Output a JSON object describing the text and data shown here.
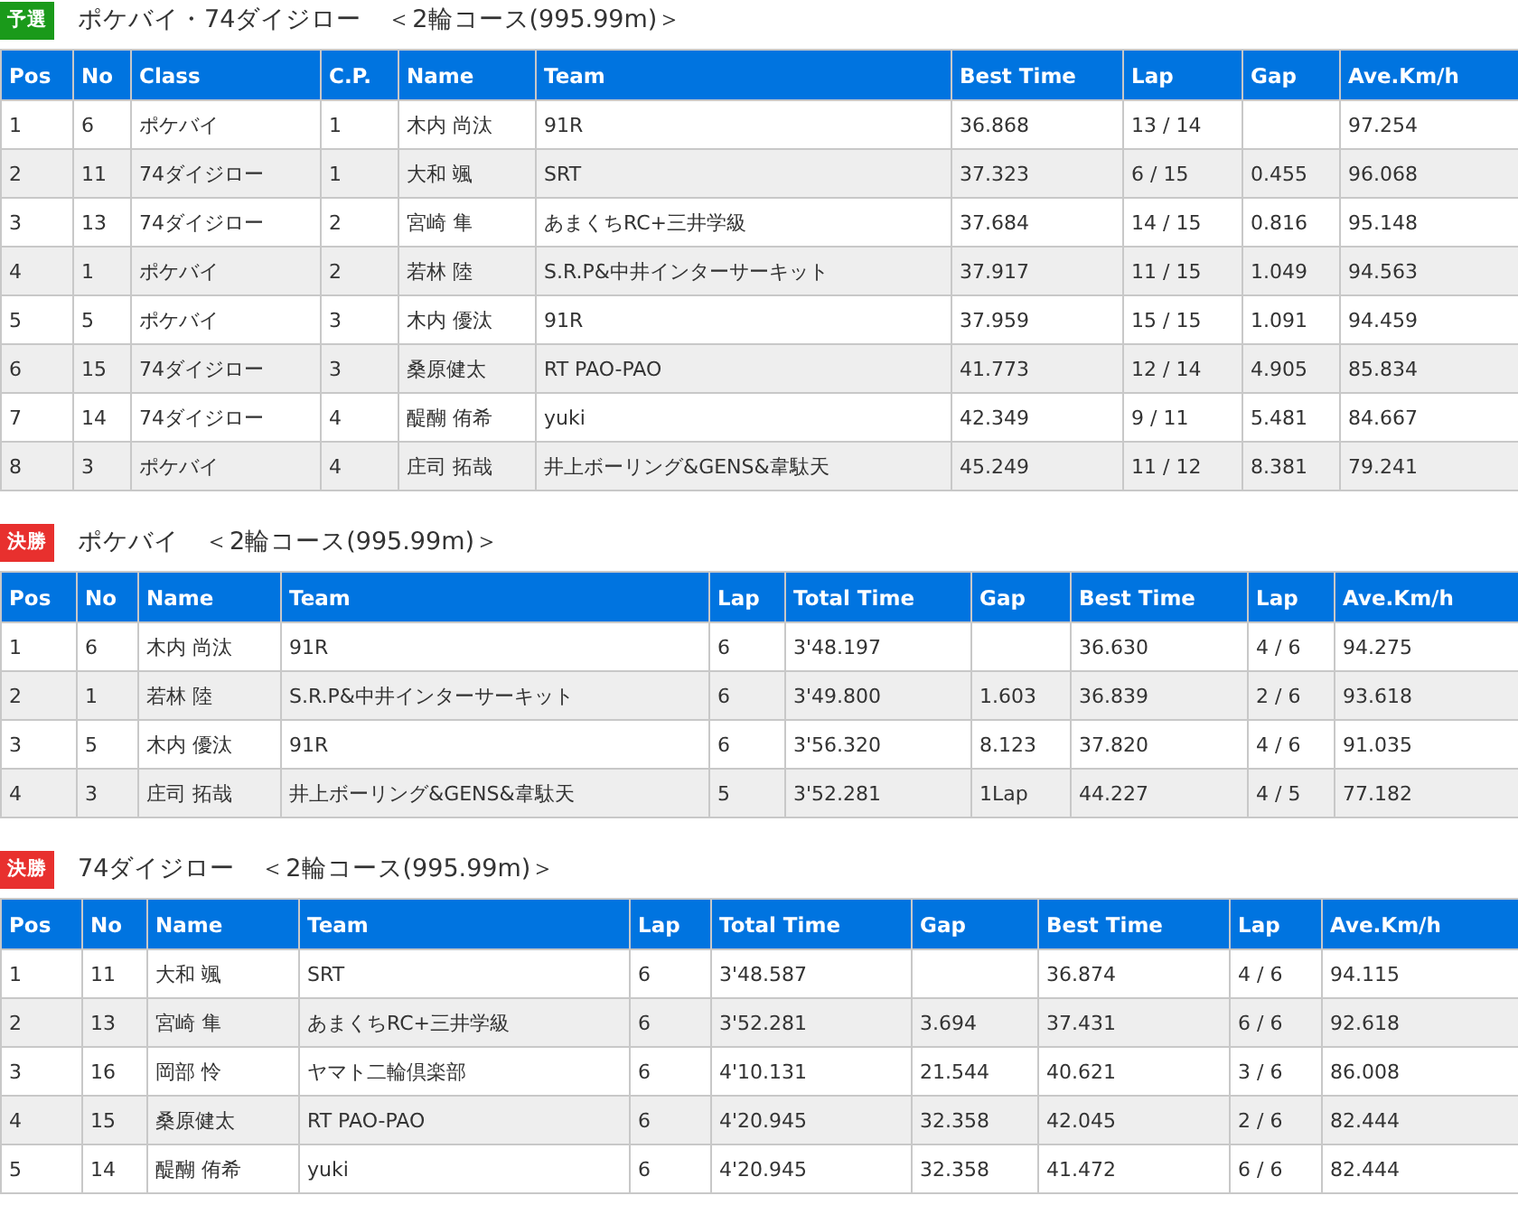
{
  "sections": [
    {
      "badge": {
        "kind": "qualifying",
        "label": "予選"
      },
      "title": "ポケバイ・74ダイジロー　＜2輪コース(995.99m)＞",
      "columns": [
        "Pos",
        "No",
        "Class",
        "C.P.",
        "Name",
        "Team",
        "Best Time",
        "Lap",
        "Gap",
        "Ave.Km/h"
      ],
      "rows": [
        [
          "1",
          "6",
          "ポケバイ",
          "1",
          "木内 尚汰",
          "91R",
          "36.868",
          "13 / 14",
          null,
          "97.254"
        ],
        [
          "2",
          "11",
          "74ダイジロー",
          "1",
          "大和 颯",
          "SRT",
          "37.323",
          "6 / 15",
          "0.455",
          "96.068"
        ],
        [
          "3",
          "13",
          "74ダイジロー",
          "2",
          "宮崎 隼",
          "あまくちRC+三井学級",
          "37.684",
          "14 / 15",
          "0.816",
          "95.148"
        ],
        [
          "4",
          "1",
          "ポケバイ",
          "2",
          "若林 陸",
          "S.R.P&中井インターサーキット",
          "37.917",
          "11 / 15",
          "1.049",
          "94.563"
        ],
        [
          "5",
          "5",
          "ポケバイ",
          "3",
          "木内 優汰",
          "91R",
          "37.959",
          "15 / 15",
          "1.091",
          "94.459"
        ],
        [
          "6",
          "15",
          "74ダイジロー",
          "3",
          "桑原健太",
          "RT PAO-PAO",
          "41.773",
          "12 / 14",
          "4.905",
          "85.834"
        ],
        [
          "7",
          "14",
          "74ダイジロー",
          "4",
          "醍醐 侑希",
          "yuki",
          "42.349",
          "9 / 11",
          "5.481",
          "84.667"
        ],
        [
          "8",
          "3",
          "ポケバイ",
          "4",
          "庄司 拓哉",
          "井上ボーリング&GENS&韋駄天",
          "45.249",
          "11 / 12",
          "8.381",
          "79.241"
        ]
      ]
    },
    {
      "badge": {
        "kind": "final",
        "label": "決勝"
      },
      "title": "ポケバイ　＜2輪コース(995.99m)＞",
      "columns": [
        "Pos",
        "No",
        "Name",
        "Team",
        "Lap",
        "Total Time",
        "Gap",
        "Best Time",
        "Lap",
        "Ave.Km/h"
      ],
      "rows": [
        [
          "1",
          "6",
          "木内 尚汰",
          "91R",
          "6",
          "3'48.197",
          null,
          "36.630",
          "4 / 6",
          "94.275"
        ],
        [
          "2",
          "1",
          "若林 陸",
          "S.R.P&中井インターサーキット",
          "6",
          "3'49.800",
          "1.603",
          "36.839",
          "2 / 6",
          "93.618"
        ],
        [
          "3",
          "5",
          "木内 優汰",
          "91R",
          "6",
          "3'56.320",
          "8.123",
          "37.820",
          "4 / 6",
          "91.035"
        ],
        [
          "4",
          "3",
          "庄司 拓哉",
          "井上ボーリング&GENS&韋駄天",
          "5",
          "3'52.281",
          "1Lap",
          "44.227",
          "4 / 5",
          "77.182"
        ]
      ]
    },
    {
      "badge": {
        "kind": "final",
        "label": "決勝"
      },
      "title": "74ダイジロー　＜2輪コース(995.99m)＞",
      "columns": [
        "Pos",
        "No",
        "Name",
        "Team",
        "Lap",
        "Total Time",
        "Gap",
        "Best Time",
        "Lap",
        "Ave.Km/h"
      ],
      "rows": [
        [
          "1",
          "11",
          "大和 颯",
          "SRT",
          "6",
          "3'48.587",
          null,
          "36.874",
          "4 / 6",
          "94.115"
        ],
        [
          "2",
          "13",
          "宮崎 隼",
          "あまくちRC+三井学級",
          "6",
          "3'52.281",
          "3.694",
          "37.431",
          "6 / 6",
          "92.618"
        ],
        [
          "3",
          "16",
          "岡部 怜",
          "ヤマト二輪倶楽部",
          "6",
          "4'10.131",
          "21.544",
          "40.621",
          "3 / 6",
          "86.008"
        ],
        [
          "4",
          "15",
          "桑原健太",
          "RT PAO-PAO",
          "6",
          "4'20.945",
          "32.358",
          "42.045",
          "2 / 6",
          "82.444"
        ],
        [
          "5",
          "14",
          "醍醐 侑希",
          "yuki",
          "6",
          "4'20.945",
          "32.358",
          "41.472",
          "6 / 6",
          "82.444"
        ]
      ]
    }
  ]
}
